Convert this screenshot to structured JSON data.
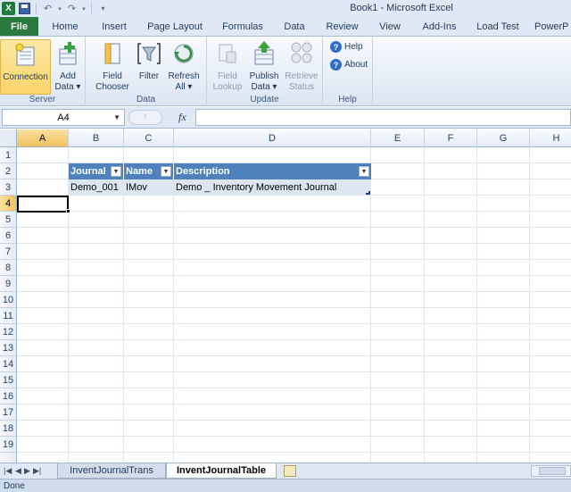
{
  "window": {
    "title": "Book1  -  Microsoft Excel"
  },
  "qat": {
    "icons": [
      "excel-logo",
      "save-icon",
      "undo-icon",
      "redo-icon",
      "customize-icon"
    ]
  },
  "tabs": [
    "File",
    "Home",
    "Insert",
    "Page Layout",
    "Formulas",
    "Data",
    "Review",
    "View",
    "Add-Ins",
    "Load Test",
    "PowerP"
  ],
  "ribbon": {
    "server": {
      "label": "Server",
      "connection": "Connection",
      "add_data_1": "Add",
      "add_data_2": "Data"
    },
    "data": {
      "label": "Data",
      "field_chooser_1": "Field",
      "field_chooser_2": "Chooser",
      "filter": "Filter",
      "refresh_1": "Refresh",
      "refresh_2": "All"
    },
    "update": {
      "label": "Update",
      "field_lookup_1": "Field",
      "field_lookup_2": "Lookup",
      "publish_1": "Publish",
      "publish_2": "Data",
      "retrieve_1": "Retrieve",
      "retrieve_2": "Status"
    },
    "help": {
      "label": "Help",
      "help": "Help",
      "about": "About"
    }
  },
  "formula_bar": {
    "name_box": "A4",
    "fx": "fx",
    "value": ""
  },
  "columns": [
    "A",
    "B",
    "C",
    "D",
    "E",
    "F",
    "G",
    "H"
  ],
  "rows": [
    "1",
    "2",
    "3",
    "4",
    "5",
    "6",
    "7",
    "8",
    "9",
    "10",
    "11",
    "12",
    "13",
    "14",
    "15",
    "16",
    "17",
    "18",
    "19"
  ],
  "table": {
    "headers": [
      "Journal",
      "Name",
      "Description"
    ],
    "row": [
      "Demo_001",
      "IMov",
      "Demo _ Inventory Movement Journal"
    ]
  },
  "sheets": {
    "tabs": [
      "InventJournalTrans",
      "InventJournalTable"
    ],
    "active": "InventJournalTable"
  },
  "status": {
    "text": "Done"
  }
}
